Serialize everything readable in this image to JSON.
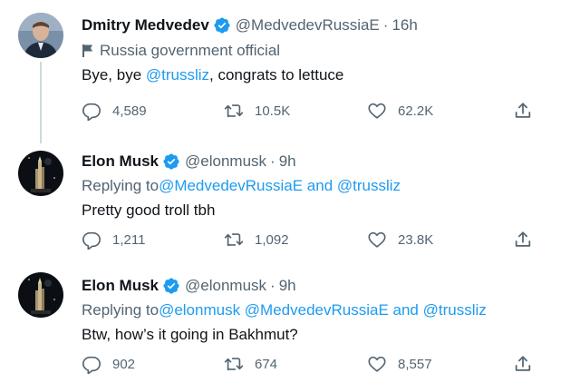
{
  "tweets": [
    {
      "author_name": "Dmitry Medvedev",
      "handle": "@MedvedevRussiaE",
      "separator": "·",
      "time": "16h",
      "affiliation_label": "Russia government official",
      "body_prefix": "Bye, bye ",
      "body_mention": "@trussliz",
      "body_suffix": ", congrats to lettuce",
      "replies": "4,589",
      "retweets": "10.5K",
      "likes": "62.2K"
    },
    {
      "author_name": "Elon Musk",
      "handle": "@elonmusk",
      "separator": "·",
      "time": "9h",
      "replying_prefix": "Replying to ",
      "replying_mentions": "@MedvedevRussiaE and @trussliz",
      "body": "Pretty good troll tbh",
      "replies": "1,211",
      "retweets": "1,092",
      "likes": "23.8K"
    },
    {
      "author_name": "Elon Musk",
      "handle": "@elonmusk",
      "separator": "·",
      "time": "9h",
      "replying_prefix": "Replying to ",
      "replying_mentions": "@elonmusk @MedvedevRussiaE and @trussliz",
      "body": "Btw, how’s it going in Bakhmut?",
      "replies": "902",
      "retweets": "674",
      "likes": "8,557"
    }
  ],
  "icons": {
    "verified": "verified-badge-icon",
    "government": "government-flag-icon",
    "reply": "reply-icon",
    "retweet": "retweet-icon",
    "like": "heart-icon",
    "share": "share-icon"
  },
  "colors": {
    "accent": "#1d9bf0",
    "text": "#0f1419",
    "secondary": "#536471",
    "thread_line": "#cfd9de"
  }
}
